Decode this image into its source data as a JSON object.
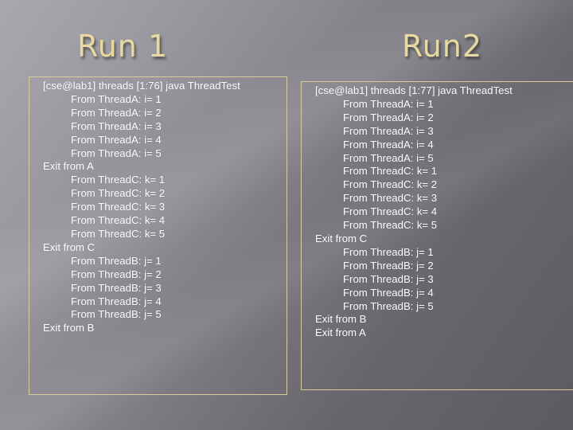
{
  "slide": {
    "accent_color": "#e8d9a0",
    "border_color": "#d8cc9a",
    "runs": [
      {
        "title": "Run 1",
        "lines": [
          {
            "level": 0,
            "text": "[cse@lab1] threads [1:76] java ThreadTest"
          },
          {
            "level": 1,
            "text": "From ThreadA: i= 1"
          },
          {
            "level": 1,
            "text": "From ThreadA: i= 2"
          },
          {
            "level": 1,
            "text": "From ThreadA: i= 3"
          },
          {
            "level": 1,
            "text": "From ThreadA: i= 4"
          },
          {
            "level": 1,
            "text": "From ThreadA: i= 5"
          },
          {
            "level": 0,
            "text": "Exit from A"
          },
          {
            "level": 1,
            "text": "From ThreadC: k= 1"
          },
          {
            "level": 1,
            "text": "From ThreadC: k= 2"
          },
          {
            "level": 1,
            "text": "From ThreadC: k= 3"
          },
          {
            "level": 1,
            "text": "From ThreadC: k= 4"
          },
          {
            "level": 1,
            "text": "From ThreadC: k= 5"
          },
          {
            "level": 0,
            "text": "Exit from C"
          },
          {
            "level": 1,
            "text": "From ThreadB: j= 1"
          },
          {
            "level": 1,
            "text": "From ThreadB: j= 2"
          },
          {
            "level": 1,
            "text": "From ThreadB: j= 3"
          },
          {
            "level": 1,
            "text": "From ThreadB: j= 4"
          },
          {
            "level": 1,
            "text": "From ThreadB: j= 5"
          },
          {
            "level": 0,
            "text": "Exit from B"
          }
        ]
      },
      {
        "title": "Run2",
        "lines": [
          {
            "level": 0,
            "text": "[cse@lab1] threads [1:77] java ThreadTest"
          },
          {
            "level": 1,
            "text": "From ThreadA: i= 1"
          },
          {
            "level": 1,
            "text": "From ThreadA: i= 2"
          },
          {
            "level": 1,
            "text": "From ThreadA: i= 3"
          },
          {
            "level": 1,
            "text": "From ThreadA: i= 4"
          },
          {
            "level": 1,
            "text": "From ThreadA: i= 5"
          },
          {
            "level": 1,
            "text": "From ThreadC: k= 1"
          },
          {
            "level": 1,
            "text": "From ThreadC: k= 2"
          },
          {
            "level": 1,
            "text": "From ThreadC: k= 3"
          },
          {
            "level": 1,
            "text": "From ThreadC: k= 4"
          },
          {
            "level": 1,
            "text": "From ThreadC: k= 5"
          },
          {
            "level": 0,
            "text": "Exit from C"
          },
          {
            "level": 1,
            "text": "From ThreadB: j= 1"
          },
          {
            "level": 1,
            "text": "From ThreadB: j= 2"
          },
          {
            "level": 1,
            "text": "From ThreadB: j= 3"
          },
          {
            "level": 1,
            "text": "From ThreadB: j= 4"
          },
          {
            "level": 1,
            "text": "From ThreadB: j= 5"
          },
          {
            "level": 0,
            "text": "Exit from B"
          },
          {
            "level": 0,
            "text": "Exit from A"
          }
        ]
      }
    ]
  }
}
